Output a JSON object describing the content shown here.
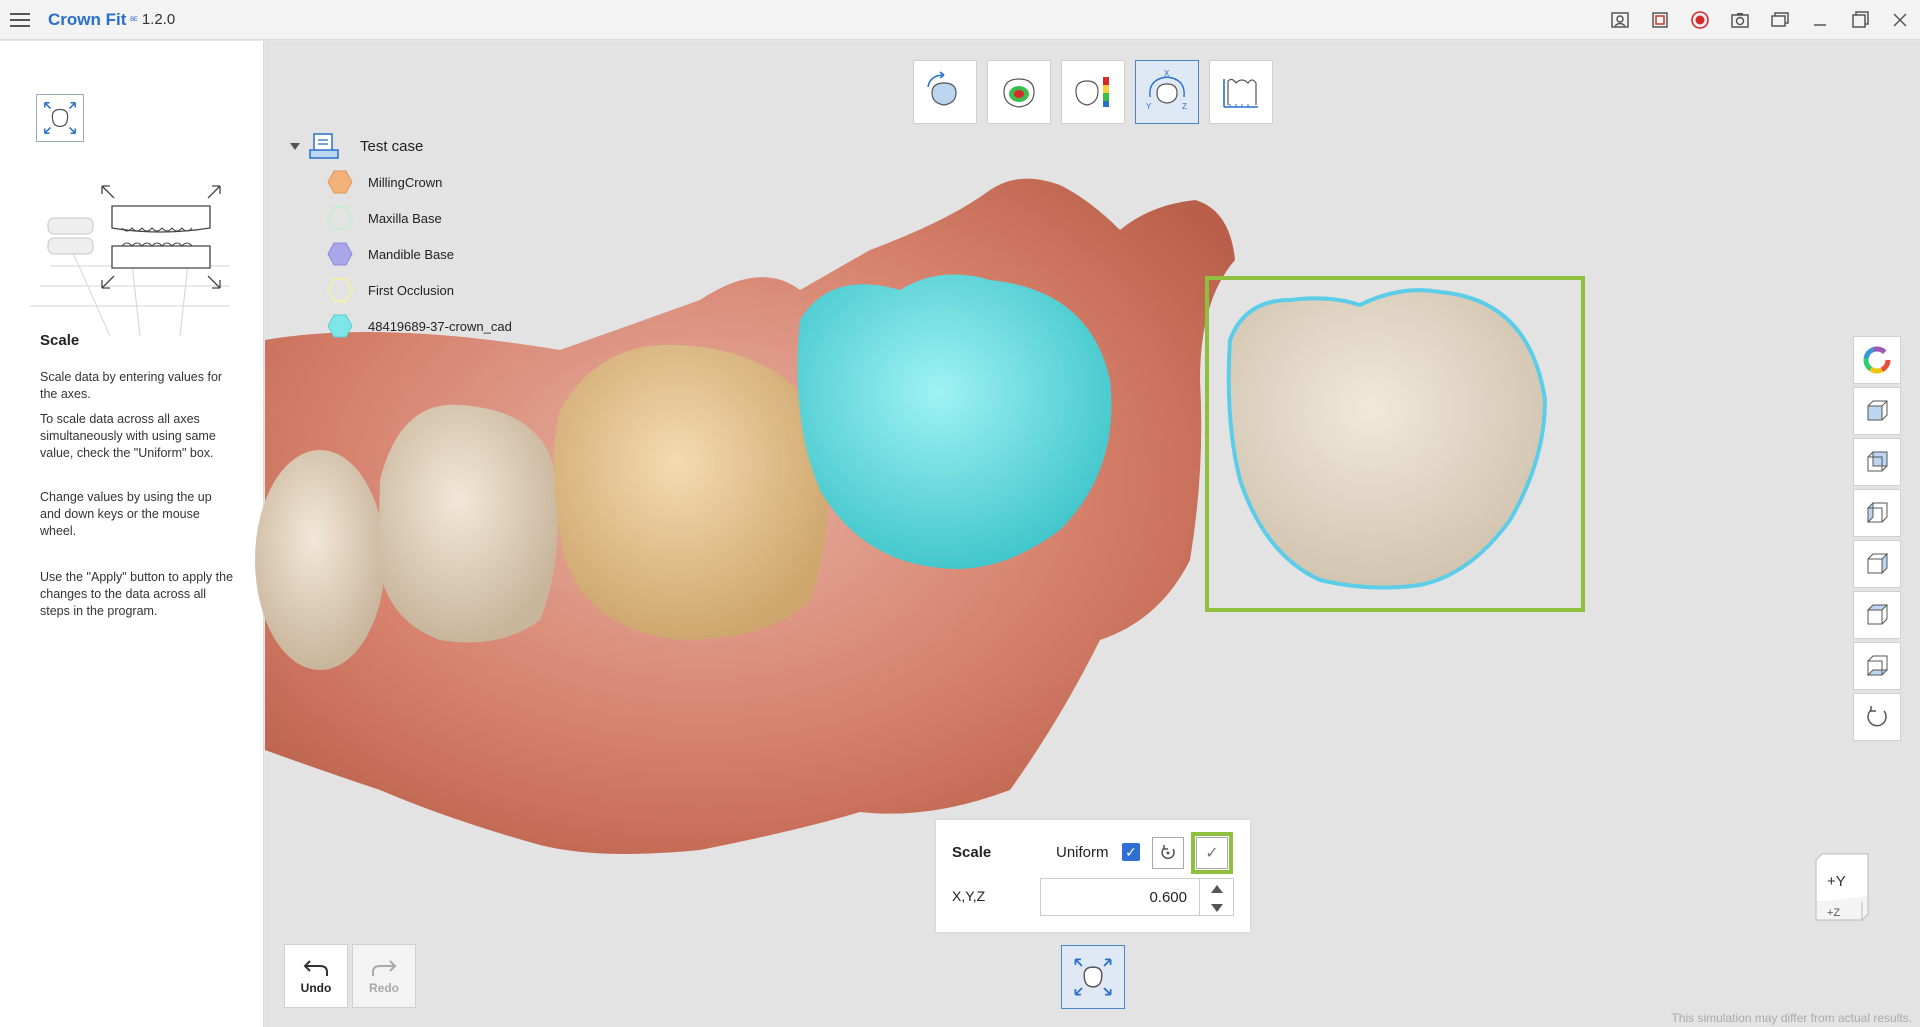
{
  "app": {
    "title": "Crown Fit",
    "badge": "ᴮᴱ",
    "version": "1.2.0"
  },
  "titlebar_icons": [
    "scan-icon",
    "capture-region-icon",
    "record-icon",
    "camera-icon",
    "window-stack-icon",
    "minimize-icon",
    "maximize-icon",
    "close-icon"
  ],
  "help": {
    "title": "Scale",
    "paragraphs": [
      "Scale data by entering values for the axes.",
      "To scale data across all axes simultaneously with using same value, check the \"Uniform\" box.",
      "Change values by using the up and down keys or the mouse wheel.",
      "Use the \"Apply\" button to apply the changes to the data across all steps in the program."
    ]
  },
  "tree": {
    "root_label": "Test case",
    "items": [
      {
        "label": "MillingCrown",
        "color": "#f4b27a"
      },
      {
        "label": "Maxilla Base",
        "color": "#c8eccf"
      },
      {
        "label": "Mandible Base",
        "color": "#a9a6ea"
      },
      {
        "label": "First Occlusion",
        "color": "#f3efb0"
      },
      {
        "label": "48419689-37-crown_cad",
        "color": "#7de6e8"
      }
    ]
  },
  "modes": [
    {
      "name": "rotate-model",
      "active": false
    },
    {
      "name": "occlusion-map",
      "active": false
    },
    {
      "name": "thickness-map",
      "active": false
    },
    {
      "name": "transform-xyz",
      "active": true
    },
    {
      "name": "measure",
      "active": false
    }
  ],
  "scale_panel": {
    "title": "Scale",
    "uniform_label": "Uniform",
    "uniform_checked": true,
    "axis_label": "X,Y,Z",
    "value": "0.600"
  },
  "undo_label": "Undo",
  "redo_label": "Redo",
  "orientation": {
    "top_label": "+Y",
    "bottom_label": "+Z"
  },
  "disclaimer": "This simulation may differ from actual results."
}
